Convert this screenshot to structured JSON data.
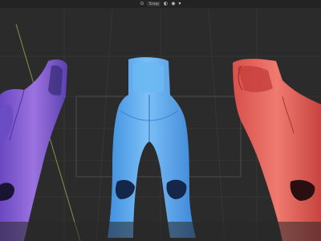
{
  "viewport_toolbar": {
    "snap_icon": "snap-icon",
    "snap_label": "Snap",
    "overlay_icon": "overlay-icon",
    "shading_icon": "shading-icon",
    "more_icon": "dropdown-chevron-icon"
  },
  "scene": {
    "background_color": "#2b2b2b",
    "grid_color": "#353535",
    "axis_color": "#8a8f4a",
    "models": [
      {
        "name": "purple-bodysuit-figure",
        "color": "#8f66d6"
      },
      {
        "name": "blue-bodysuit-figure",
        "color": "#5aa7ee"
      },
      {
        "name": "red-bodysuit-figure",
        "color": "#e35b56"
      }
    ]
  }
}
